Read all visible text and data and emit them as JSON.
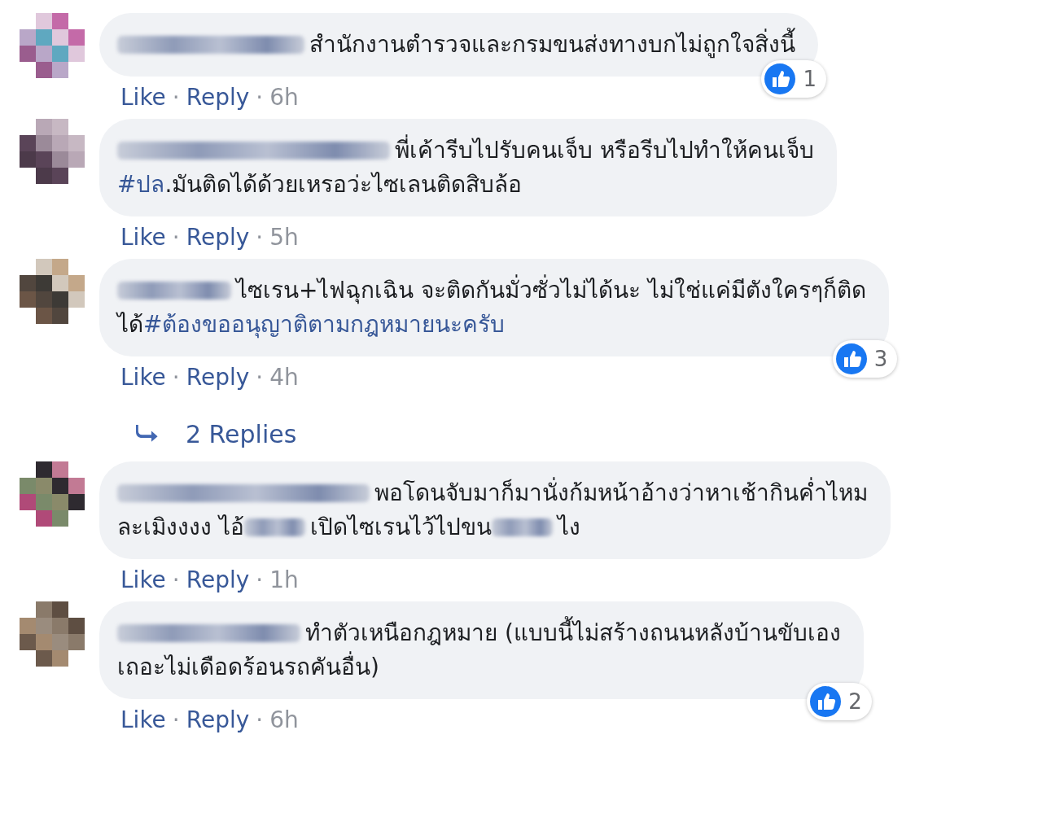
{
  "comments": [
    {
      "avatar": {
        "kind": "picture"
      },
      "segments": [
        {
          "kind": "redacted"
        },
        {
          "kind": "text",
          "text": "สำนักงานตำรวจและกรมขนส่งทางบกไม่ถูกใจสิ่งนี้"
        }
      ],
      "reactions": "1",
      "actions": [
        {
          "kind": "link",
          "text": "Like"
        },
        {
          "kind": "sep",
          "text": "·"
        },
        {
          "kind": "link",
          "text": "Reply"
        },
        {
          "kind": "sep",
          "text": "·"
        },
        {
          "kind": "time",
          "text": "6h"
        }
      ]
    },
    {
      "avatar": {
        "kind": "picture"
      },
      "segments": [
        {
          "kind": "redacted"
        },
        {
          "kind": "text",
          "text": "พี่เค้ารีบไปรับคนเจ็บ หรือรีบไปทำให้คนเจ็บ"
        },
        {
          "kind": "break"
        },
        {
          "kind": "hashtag",
          "text": "#ปล"
        },
        {
          "kind": "text",
          "text": ".มันติดได้ด้วยเหรอว่ะไซเลนติดสิบล้อ"
        }
      ],
      "actions": [
        {
          "kind": "link",
          "text": "Like"
        },
        {
          "kind": "sep",
          "text": "·"
        },
        {
          "kind": "link",
          "text": "Reply"
        },
        {
          "kind": "sep",
          "text": "·"
        },
        {
          "kind": "time",
          "text": "5h"
        }
      ]
    },
    {
      "avatar": {
        "kind": "picture"
      },
      "segments": [
        {
          "kind": "redacted"
        },
        {
          "kind": "text",
          "text": "ไซเรน+ไฟฉุกเฉิน จะติดกันมั่วซั่วไม่ได้นะ ไม่ใช่แค่มีตังใครๆก็ติด"
        },
        {
          "kind": "break"
        },
        {
          "kind": "text",
          "text": "ได้"
        },
        {
          "kind": "hashtag",
          "text": "#ต้องขออนุญาติตามกฎหมายนะครับ"
        }
      ],
      "reactions": "3",
      "actions": [
        {
          "kind": "link",
          "text": "Like"
        },
        {
          "kind": "sep",
          "text": "·"
        },
        {
          "kind": "link",
          "text": "Reply"
        },
        {
          "kind": "sep",
          "text": "·"
        },
        {
          "kind": "time",
          "text": "4h"
        }
      ],
      "replies": "2 Replies"
    },
    {
      "avatar": {
        "kind": "picture"
      },
      "segments": [
        {
          "kind": "redacted"
        },
        {
          "kind": "text",
          "text": "พอโดนจับมาก็มานั่งก้มหน้าอ้างว่าหาเช้ากินค่ำไหม"
        },
        {
          "kind": "break"
        },
        {
          "kind": "text",
          "text": "ละเมิงงงง ไอ้"
        },
        {
          "kind": "redacted"
        },
        {
          "kind": "text",
          "text": "เปิดไซเรนไว้ไปขน"
        },
        {
          "kind": "redacted"
        },
        {
          "kind": "text",
          "text": "ไง"
        }
      ],
      "actions": [
        {
          "kind": "link",
          "text": "Like"
        },
        {
          "kind": "sep",
          "text": "·"
        },
        {
          "kind": "link",
          "text": "Reply"
        },
        {
          "kind": "sep",
          "text": "·"
        },
        {
          "kind": "time",
          "text": "1h"
        }
      ]
    },
    {
      "avatar": {
        "kind": "picture"
      },
      "segments": [
        {
          "kind": "redacted"
        },
        {
          "kind": "text",
          "text": "ทำตัวเหนือกฎหมาย (แบบนี้ไม่สร้างถนนหลังบ้านขับเอง"
        },
        {
          "kind": "break"
        },
        {
          "kind": "text",
          "text": "เถอะไม่เดือดร้อนรถคันอื่น)"
        }
      ],
      "reactions": "2",
      "actions": [
        {
          "kind": "link",
          "text": "Like"
        },
        {
          "kind": "sep",
          "text": "·"
        },
        {
          "kind": "link",
          "text": "Reply"
        },
        {
          "kind": "sep",
          "text": "·"
        },
        {
          "kind": "time",
          "text": "6h"
        }
      ]
    }
  ]
}
